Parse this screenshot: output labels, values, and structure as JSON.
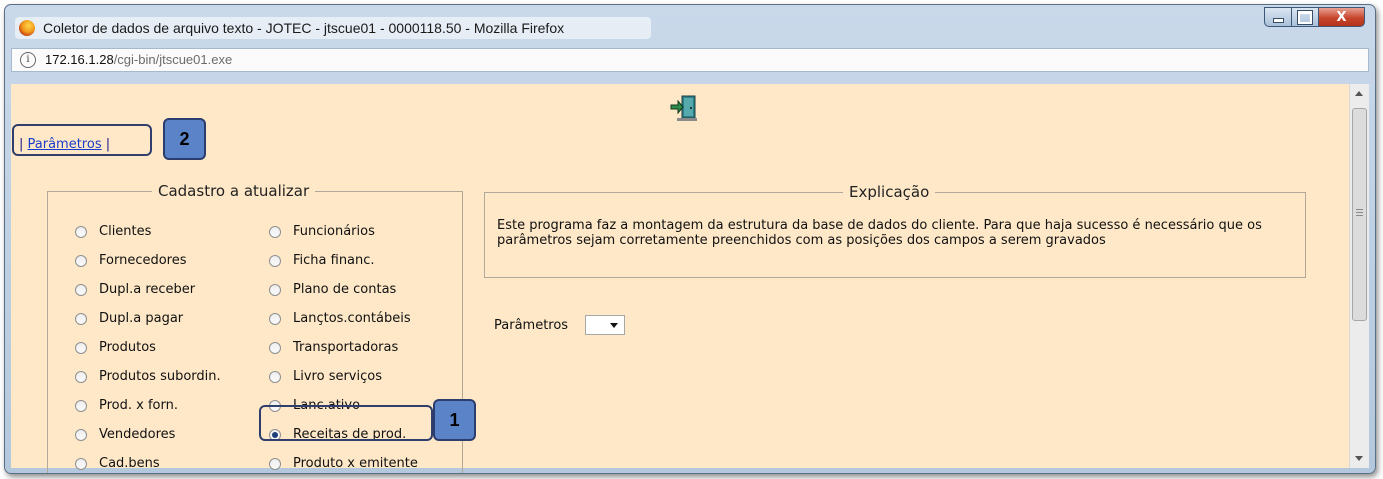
{
  "window": {
    "title": "Coletor de dados de arquivo texto - JOTEC - jtscue01 - 0000118.50 - Mozilla Firefox",
    "url_host": "172.16.1.28",
    "url_path": "/cgi-bin/jtscue01.exe",
    "controls": {
      "minimize": "minimize-icon",
      "maximize": "maximize-icon",
      "close": "X"
    }
  },
  "nav": {
    "prefix": "| ",
    "link": "Parâmetros",
    "suffix": " |"
  },
  "callouts": {
    "one": "1",
    "two": "2"
  },
  "cadastro": {
    "legend": "Cadastro a atualizar",
    "left": [
      {
        "label": "Clientes",
        "checked": false
      },
      {
        "label": "Fornecedores",
        "checked": false
      },
      {
        "label": "Dupl.a receber",
        "checked": false
      },
      {
        "label": "Dupl.a pagar",
        "checked": false
      },
      {
        "label": "Produtos",
        "checked": false
      },
      {
        "label": "Produtos subordin.",
        "checked": false
      },
      {
        "label": "Prod. x forn.",
        "checked": false
      },
      {
        "label": "Vendedores",
        "checked": false
      },
      {
        "label": "Cad.bens",
        "checked": false
      }
    ],
    "right": [
      {
        "label": "Funcionários",
        "checked": false
      },
      {
        "label": "Ficha financ.",
        "checked": false
      },
      {
        "label": "Plano de contas",
        "checked": false
      },
      {
        "label": "Lançtos.contábeis",
        "checked": false
      },
      {
        "label": "Transportadoras",
        "checked": false
      },
      {
        "label": "Livro serviços",
        "checked": false
      },
      {
        "label": "Lanc.ativo",
        "checked": false
      },
      {
        "label": "Receitas de prod.",
        "checked": true
      },
      {
        "label": "Produto x emitente",
        "checked": false
      }
    ]
  },
  "explicacao": {
    "legend": "Explicação",
    "text": "Este programa faz a montagem da estrutura da base de dados do cliente. Para que haja sucesso é necessário que os parâmetros sejam corretamente preenchidos com as posições dos campos a serem gravados"
  },
  "parametros": {
    "label": "Parâmetros",
    "selected": ""
  },
  "colors": {
    "content_bg": "#fee8c8",
    "callout_fill": "#5b84c8",
    "callout_border": "#2f3e6c",
    "link": "#1a3ccb"
  },
  "icons": {
    "browser": "firefox-icon",
    "site_info": "info-icon",
    "exit": "exit-door-icon"
  }
}
